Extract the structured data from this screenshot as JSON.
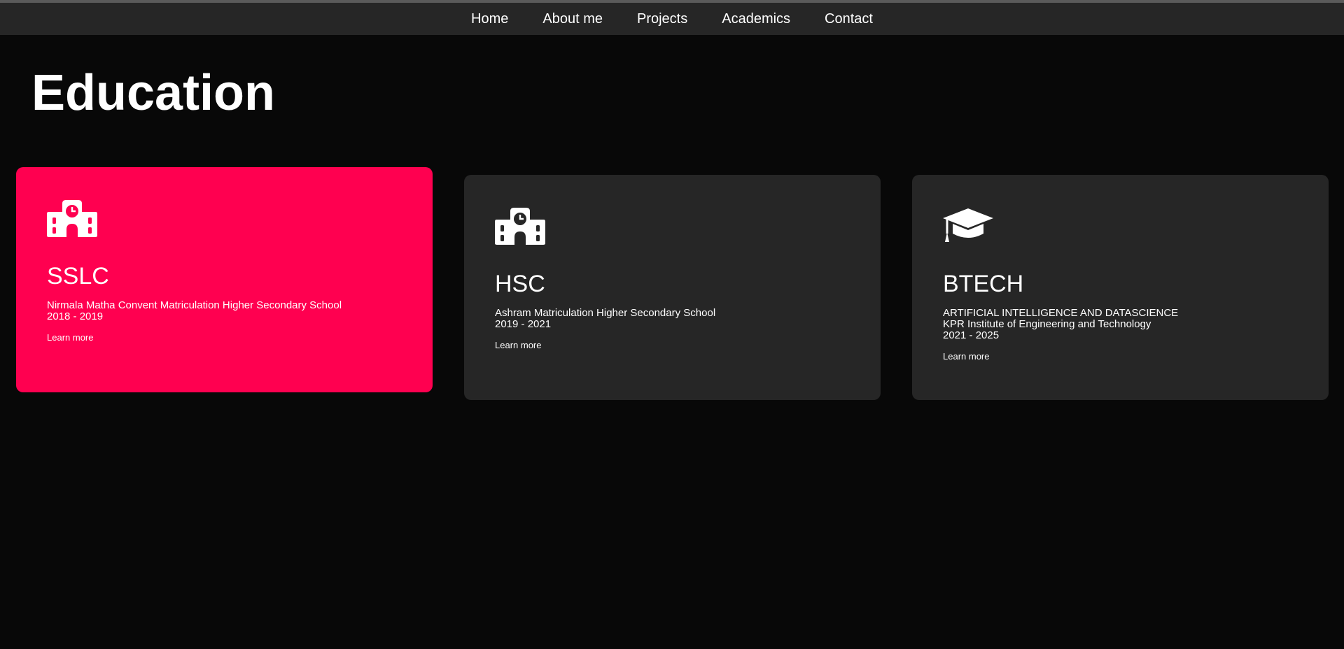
{
  "nav": {
    "items": [
      {
        "label": "Home"
      },
      {
        "label": "About me"
      },
      {
        "label": "Projects"
      },
      {
        "label": "Academics"
      },
      {
        "label": "Contact"
      }
    ]
  },
  "page": {
    "title": "Education"
  },
  "colors": {
    "accent": "#ff0050",
    "card_bg": "#262626",
    "page_bg": "#080808",
    "nav_bg": "#262626"
  },
  "cards": [
    {
      "icon": "school-icon",
      "title": "SSLC",
      "lines": [
        "Nirmala Matha Convent Matriculation Higher Secondary School",
        "2018 - 2019"
      ],
      "link": "Learn more",
      "active": true
    },
    {
      "icon": "school-icon",
      "title": "HSC",
      "lines": [
        "Ashram Matriculation Higher Secondary School",
        "2019 - 2021"
      ],
      "link": "Learn more",
      "active": false
    },
    {
      "icon": "graduation-cap-icon",
      "title": "BTECH",
      "lines": [
        "ARTIFICIAL INTELLIGENCE AND DATASCIENCE",
        "KPR Institute of Engineering and Technology",
        "2021 - 2025"
      ],
      "link": "Learn more",
      "active": false
    }
  ]
}
